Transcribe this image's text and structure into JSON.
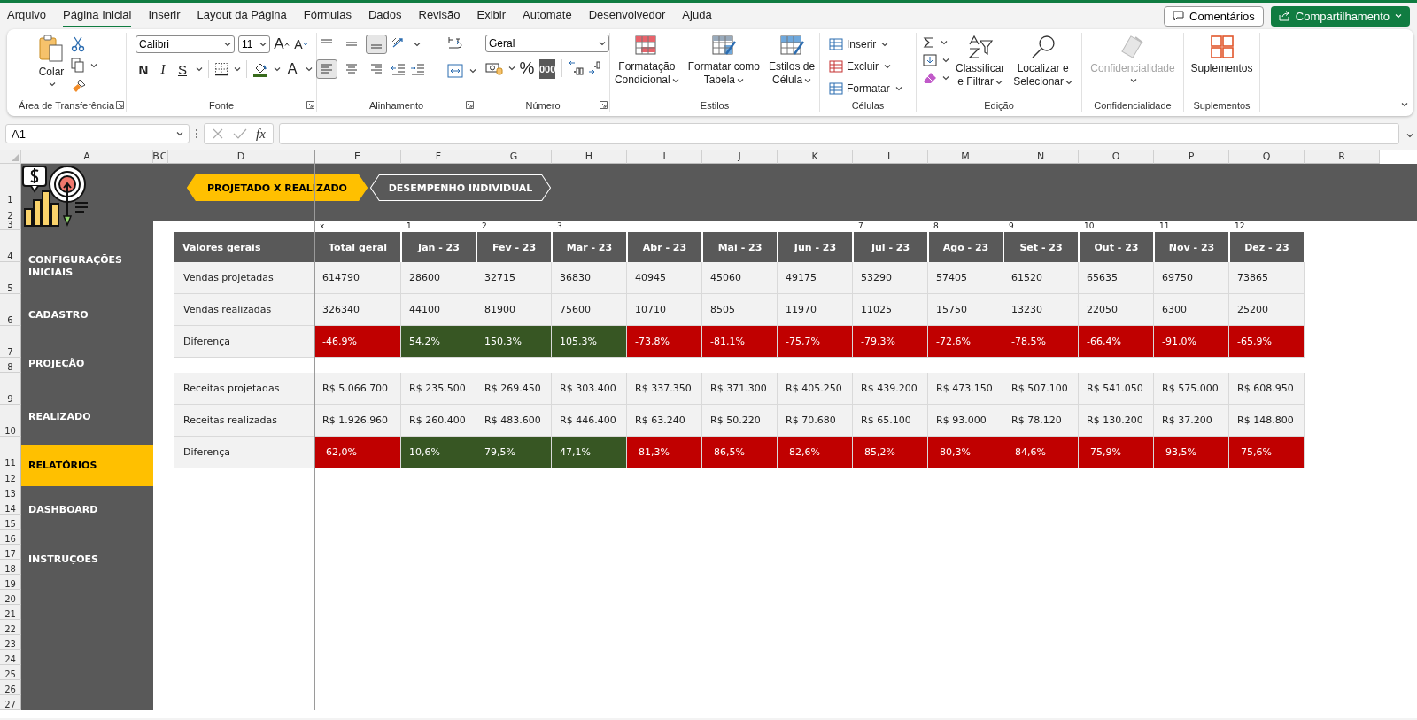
{
  "menu_tabs": [
    {
      "label": "Arquivo",
      "selected": false
    },
    {
      "label": "Página Inicial",
      "selected": true
    },
    {
      "label": "Inserir",
      "selected": false
    },
    {
      "label": "Layout da Página",
      "selected": false
    },
    {
      "label": "Fórmulas",
      "selected": false
    },
    {
      "label": "Dados",
      "selected": false
    },
    {
      "label": "Revisão",
      "selected": false
    },
    {
      "label": "Exibir",
      "selected": false
    },
    {
      "label": "Automate",
      "selected": false
    },
    {
      "label": "Desenvolvedor",
      "selected": false
    },
    {
      "label": "Ajuda",
      "selected": false
    }
  ],
  "comments_button": "Comentários",
  "share_button": "Compartilhamento",
  "ribbon": {
    "clipboard": {
      "label": "Área de Transferência",
      "paste": "Colar"
    },
    "font": {
      "label": "Fonte",
      "font_name": "Calibri",
      "font_size": "11",
      "grow": "A",
      "shrink": "A",
      "bold": "N",
      "italic": "I",
      "underline": "S",
      "font_color_label": "A"
    },
    "alignment": {
      "label": "Alinhamento",
      "vertical": [
        {
          "kind": "top",
          "selected": false
        },
        {
          "kind": "middle",
          "selected": false
        },
        {
          "kind": "bottom",
          "selected": true
        }
      ],
      "horizontal": [
        {
          "kind": "left",
          "selected": true
        },
        {
          "kind": "center",
          "selected": false
        },
        {
          "kind": "right",
          "selected": false
        }
      ]
    },
    "number": {
      "label": "Número",
      "format": "Geral",
      "percent": "%",
      "thousands": "000"
    },
    "styles": {
      "label": "Estilos",
      "buttons": [
        {
          "lines": [
            "Formatação",
            "Condicional"
          ],
          "kind": "conditional"
        },
        {
          "lines": [
            "Formatar como",
            "Tabela"
          ],
          "kind": "table"
        },
        {
          "lines": [
            "Estilos de",
            "Célula"
          ],
          "kind": "cell"
        }
      ]
    },
    "cells": {
      "label": "Células",
      "buttons": [
        {
          "label": "Inserir",
          "kind": "insert"
        },
        {
          "label": "Excluir",
          "kind": "delete"
        },
        {
          "label": "Formatar",
          "kind": "format"
        }
      ]
    },
    "editing": {
      "label": "Edição",
      "buttons": [
        {
          "lines": [
            "Classificar",
            "e Filtrar"
          ],
          "kind": "sort"
        },
        {
          "lines": [
            "Localizar e",
            "Selecionar"
          ],
          "kind": "find"
        }
      ]
    },
    "sensitivity": {
      "label": "Confidencialidade",
      "button": "Confidencialidade",
      "disabled": true
    },
    "addins": {
      "label": "Suplementos",
      "button": "Suplementos"
    }
  },
  "formula_bar": {
    "name_box": "A1",
    "function_label": "fx"
  },
  "sheet": {
    "column_letters": [
      "A",
      "B",
      "C",
      "D",
      "E",
      "F",
      "G",
      "H",
      "I",
      "J",
      "K",
      "L",
      "M",
      "N",
      "O",
      "P",
      "Q",
      "R"
    ],
    "row_numbers": [
      "1",
      "2",
      "3",
      "4",
      "5",
      "6",
      "7",
      "8",
      "9",
      "10",
      "11",
      "12",
      "13",
      "14",
      "15",
      "16",
      "17",
      "18",
      "19",
      "20",
      "21",
      "22",
      "23",
      "24",
      "25",
      "26",
      "27"
    ],
    "nav_tabs": [
      {
        "label": "PROJETADO X REALIZADO",
        "selected": true
      },
      {
        "label": "DESEMPENHO INDIVIDUAL",
        "selected": false
      }
    ],
    "sidebar": [
      {
        "label": "CONFIGURAÇÕES INICIAIS",
        "selected": false
      },
      {
        "label": "CADASTRO",
        "selected": false
      },
      {
        "label": "PROJEÇÃO",
        "selected": false
      },
      {
        "label": "REALIZADO",
        "selected": false
      },
      {
        "label": "RELATÓRIOS",
        "selected": true
      },
      {
        "label": "DASHBOARD",
        "selected": false
      },
      {
        "label": "INSTRUÇÕES",
        "selected": false
      }
    ],
    "table": {
      "corner": "Valores gerais",
      "columns": [
        {
          "header": "Total geral",
          "marker": "x"
        },
        {
          "header": "Jan - 23",
          "marker": "1"
        },
        {
          "header": "Fev - 23",
          "marker": "2"
        },
        {
          "header": "Mar - 23",
          "marker": "3"
        },
        {
          "header": "Abr - 23"
        },
        {
          "header": "Mai - 23"
        },
        {
          "header": "Jun - 23"
        },
        {
          "header": "Jul - 23",
          "marker": "7"
        },
        {
          "header": "Ago - 23",
          "marker": "8"
        },
        {
          "header": "Set - 23",
          "marker": "9"
        },
        {
          "header": "Out - 23",
          "marker": "10"
        },
        {
          "header": "Nov - 23",
          "marker": "11"
        },
        {
          "header": "Dez - 23",
          "marker": "12"
        }
      ],
      "sections": [
        [
          {
            "label": "Vendas projetadas",
            "kind": "value",
            "cells": [
              "614790",
              "28600",
              "32715",
              "36830",
              "40945",
              "45060",
              "49175",
              "53290",
              "57405",
              "61520",
              "65635",
              "69750",
              "73865"
            ]
          },
          {
            "label": "Vendas realizadas",
            "kind": "value",
            "cells": [
              "326340",
              "44100",
              "81900",
              "75600",
              "10710",
              "8505",
              "11970",
              "11025",
              "15750",
              "13230",
              "22050",
              "6300",
              "25200"
            ]
          },
          {
            "label": "Diferença",
            "kind": "difference",
            "cells": [
              {
                "value": "-46,9%",
                "good": false
              },
              {
                "value": "54,2%",
                "good": true
              },
              {
                "value": "150,3%",
                "good": true
              },
              {
                "value": "105,3%",
                "good": true
              },
              {
                "value": "-73,8%",
                "good": false
              },
              {
                "value": "-81,1%",
                "good": false
              },
              {
                "value": "-75,7%",
                "good": false
              },
              {
                "value": "-79,3%",
                "good": false
              },
              {
                "value": "-72,6%",
                "good": false
              },
              {
                "value": "-78,5%",
                "good": false
              },
              {
                "value": "-66,4%",
                "good": false
              },
              {
                "value": "-91,0%",
                "good": false
              },
              {
                "value": "-65,9%",
                "good": false
              }
            ]
          }
        ],
        [
          {
            "label": "Receitas projetadas",
            "kind": "value",
            "cells": [
              "R$ 5.066.700",
              "R$ 235.500",
              "R$ 269.450",
              "R$ 303.400",
              "R$ 337.350",
              "R$ 371.300",
              "R$ 405.250",
              "R$ 439.200",
              "R$ 473.150",
              "R$ 507.100",
              "R$ 541.050",
              "R$ 575.000",
              "R$ 608.950"
            ]
          },
          {
            "label": "Receitas realizadas",
            "kind": "value",
            "cells": [
              "R$ 1.926.960",
              "R$ 260.400",
              "R$ 483.600",
              "R$ 446.400",
              "R$ 63.240",
              "R$ 50.220",
              "R$ 70.680",
              "R$ 65.100",
              "R$ 93.000",
              "R$ 78.120",
              "R$ 130.200",
              "R$ 37.200",
              "R$ 148.800"
            ]
          },
          {
            "label": "Diferença",
            "kind": "difference",
            "cells": [
              {
                "value": "-62,0%",
                "good": false
              },
              {
                "value": "10,6%",
                "good": true
              },
              {
                "value": "79,5%",
                "good": true
              },
              {
                "value": "47,1%",
                "good": true
              },
              {
                "value": "-81,3%",
                "good": false
              },
              {
                "value": "-86,5%",
                "good": false
              },
              {
                "value": "-82,6%",
                "good": false
              },
              {
                "value": "-85,2%",
                "good": false
              },
              {
                "value": "-80,3%",
                "good": false
              },
              {
                "value": "-84,6%",
                "good": false
              },
              {
                "value": "-75,9%",
                "good": false
              },
              {
                "value": "-93,5%",
                "good": false
              },
              {
                "value": "-75,6%",
                "good": false
              }
            ]
          }
        ]
      ]
    }
  }
}
